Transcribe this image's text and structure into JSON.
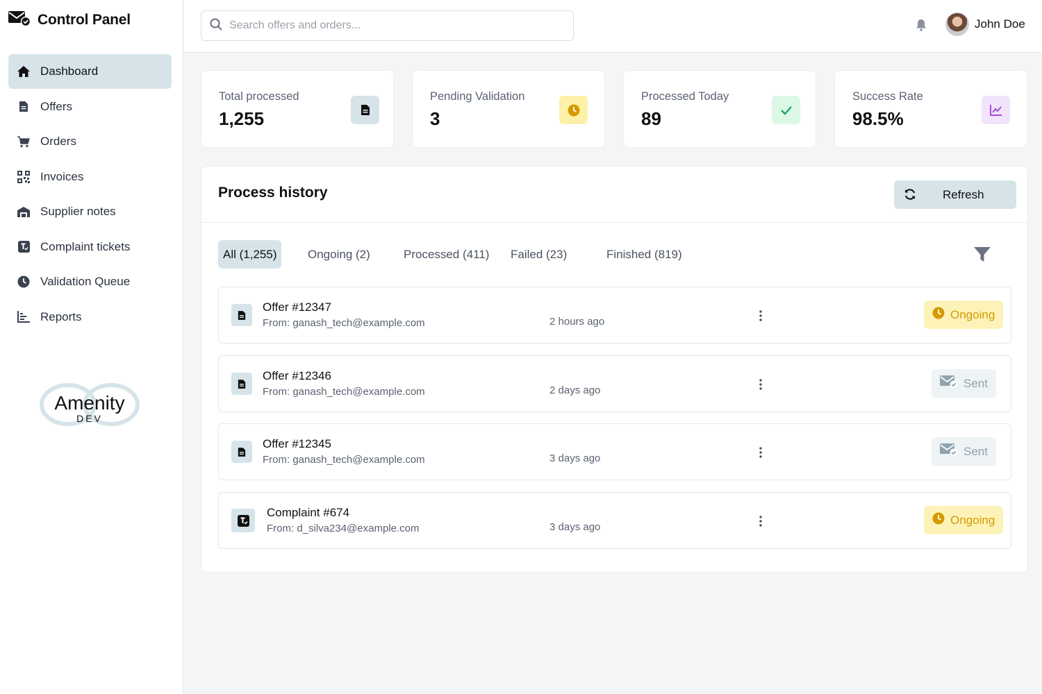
{
  "app": {
    "title": "Control Panel"
  },
  "sidebar": {
    "items": [
      {
        "label": "Dashboard",
        "icon": "home-icon"
      },
      {
        "label": "Offers",
        "icon": "document-icon"
      },
      {
        "label": "Orders",
        "icon": "cart-icon"
      },
      {
        "label": "Invoices",
        "icon": "qr-code-icon"
      },
      {
        "label": "Supplier notes",
        "icon": "warehouse-icon"
      },
      {
        "label": "Complaint tickets",
        "icon": "ticket-icon"
      },
      {
        "label": "Validation Queue",
        "icon": "clock-icon"
      },
      {
        "label": "Reports",
        "icon": "bar-chart-icon"
      }
    ],
    "active": "Dashboard",
    "logo": {
      "line1": "Amenity",
      "line2": "DEV"
    }
  },
  "header": {
    "search_placeholder": "Search offers and orders...",
    "user_name": "John Doe"
  },
  "stats": [
    {
      "label": "Total processed",
      "value": "1,255",
      "icon": "document-icon",
      "badge_bg": "#d6e4ea",
      "icon_color": "#111111"
    },
    {
      "label": "Pending Validation",
      "value": "3",
      "icon": "clock-icon",
      "badge_bg": "#fdf0a8",
      "icon_color": "#d59a00"
    },
    {
      "label": "Processed Today",
      "value": "89",
      "icon": "check-icon",
      "badge_bg": "#dcf7e6",
      "icon_color": "#1fa855"
    },
    {
      "label": "Success Rate",
      "value": "98.5%",
      "icon": "trend-chart-icon",
      "badge_bg": "#f1e4fb",
      "icon_color": "#a64bd8"
    }
  ],
  "history": {
    "title": "Process history",
    "refresh_label": "Refresh",
    "tabs": [
      "All (1,255)",
      "Ongoing (2)",
      "Processed (411)",
      "Failed (23)",
      "Finished (819)"
    ],
    "active_tab": "All (1,255)",
    "rows": [
      {
        "title": "Offer #12347",
        "from": "From: ganash_tech@example.com",
        "time": "2 hours ago",
        "status": "Ongoing",
        "kind": "offer"
      },
      {
        "title": "Offer #12346",
        "from": "From: ganash_tech@example.com",
        "time": "2 days ago",
        "status": "Sent",
        "kind": "offer"
      },
      {
        "title": "Offer #12345",
        "from": "From: ganash_tech@example.com",
        "time": "3 days ago",
        "status": "Sent",
        "kind": "offer"
      },
      {
        "title": "Complaint #674",
        "from": "From: d_silva234@example.com",
        "time": "3 days ago",
        "status": "Ongoing",
        "kind": "complaint"
      }
    ]
  },
  "colors": {
    "accent": "#d6e4ea",
    "ongoing_bg": "#fdf3b8",
    "ongoing_fg": "#d59a00",
    "sent_bg": "#eef3f5",
    "sent_fg": "#8ea4ae"
  }
}
